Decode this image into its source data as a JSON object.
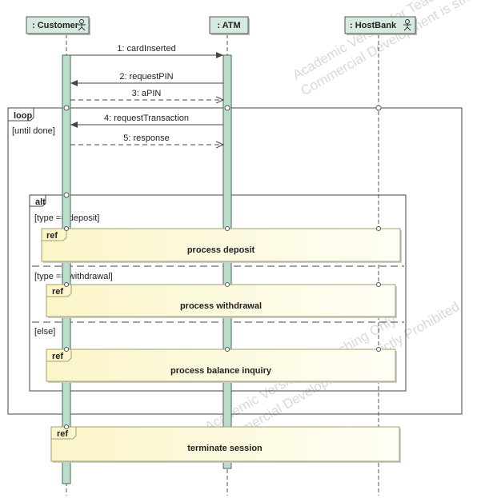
{
  "lifelines": [
    {
      "label": ": Customer",
      "actor": true
    },
    {
      "label": ": ATM",
      "actor": false
    },
    {
      "label": ": HostBank",
      "actor": true
    }
  ],
  "messages": [
    {
      "label": "1: cardInserted",
      "kind": "sync"
    },
    {
      "label": "2: requestPIN",
      "kind": "sync"
    },
    {
      "label": "3: aPIN",
      "kind": "reply"
    },
    {
      "label": "4: requestTransaction",
      "kind": "sync"
    },
    {
      "label": "5: response",
      "kind": "reply"
    }
  ],
  "loop": {
    "tag": "loop",
    "guard": "[until done]"
  },
  "alt": {
    "tag": "alt",
    "guards": [
      "[type == deposit]",
      "[type == withdrawal]",
      "[else]"
    ]
  },
  "refs": [
    {
      "tag": "ref",
      "label": "process deposit"
    },
    {
      "tag": "ref",
      "label": "process withdrawal"
    },
    {
      "tag": "ref",
      "label": "process balance inquiry"
    },
    {
      "tag": "ref",
      "label": "terminate session"
    }
  ],
  "watermark": [
    "Academic Version for Teaching Only",
    "Commercial Development is strictly Prohibited"
  ],
  "colors": {
    "lifeline_header": "#d6ebe0",
    "activation": "#bcdccc",
    "ref_fill": "#fdf8d8",
    "ref_border": "#a0a070"
  }
}
